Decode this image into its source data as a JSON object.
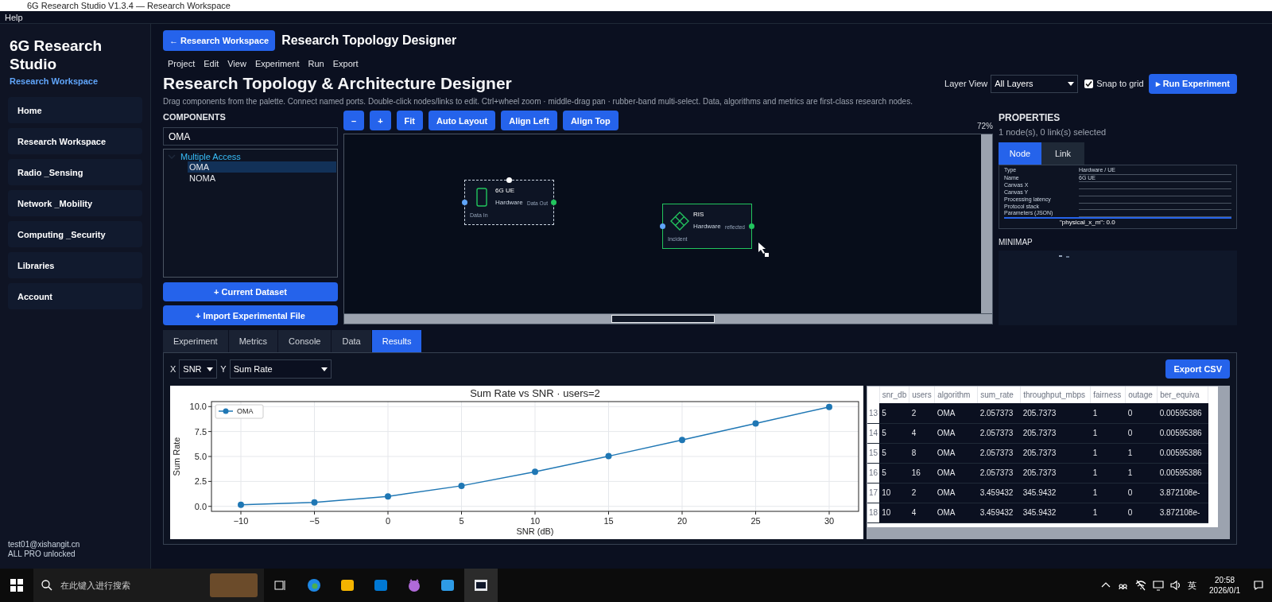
{
  "window": {
    "title": "6G Research Studio V1.3.4 — Research Workspace"
  },
  "menu_bar": [
    "Help"
  ],
  "sidebar": {
    "app_name": "6G Research Studio",
    "subtitle": "Research Workspace",
    "items": [
      {
        "label": "Home",
        "selected": false
      },
      {
        "label": "Research Workspace",
        "selected": false
      },
      {
        "label": "Radio _Sensing",
        "selected": false
      },
      {
        "label": "Network _Mobility",
        "selected": false
      },
      {
        "label": "Computing _Security",
        "selected": false
      },
      {
        "label": "Libraries",
        "selected": false
      },
      {
        "label": "Account",
        "selected": false
      }
    ],
    "user": "test01@xishangit.cn",
    "license": "ALL PRO unlocked"
  },
  "header": {
    "back_button": "← Research Workspace",
    "title": "Research Topology Designer",
    "menu": [
      "Project",
      "Edit",
      "View",
      "Experiment",
      "Run",
      "Export"
    ],
    "heading": "Research Topology & Architecture Designer",
    "description": "Drag components from the palette. Connect named ports. Double-click nodes/links to edit. Ctrl+wheel zoom · middle-drag pan · rubber-band multi-select. Data, algorithms and metrics are first-class research nodes.",
    "layer_view_label": "Layer View",
    "layer_view": "All Layers",
    "snap_to_grid": {
      "label": "Snap to grid",
      "checked": true
    },
    "run_button": "▸ Run Experiment"
  },
  "components": {
    "title": "COMPONENTS",
    "search": "OMA",
    "tree": [
      {
        "label": "Multiple Access",
        "expanded": true,
        "selected": false,
        "children": [
          {
            "label": "OMA",
            "selected": true
          },
          {
            "label": "NOMA",
            "selected": false
          }
        ]
      }
    ],
    "buttons": [
      "+ Current Dataset",
      "+ Import Experimental File"
    ]
  },
  "canvas": {
    "toolbar": [
      "–",
      "+",
      "Fit",
      "Auto Layout",
      "Align Left",
      "Align Top"
    ],
    "zoom": "72%",
    "nodes": [
      {
        "name": "6G UE",
        "type": "Hardware",
        "kind": "phone",
        "selected": true,
        "in_port": "Data In",
        "out_port": "Data Out"
      },
      {
        "name": "RIS",
        "type": "Hardware",
        "kind": "ris",
        "selected": false,
        "in_port": "Incident",
        "out_port": "reflected"
      }
    ]
  },
  "properties": {
    "title": "PROPERTIES",
    "selection": "1 node(s), 0 link(s) selected",
    "tabs": [
      {
        "label": "Node",
        "selected": true
      },
      {
        "label": "Link",
        "selected": false
      }
    ],
    "fields": [
      {
        "label": "Type",
        "value": "Hardware / UE"
      },
      {
        "label": "Name",
        "value": "6G UE"
      },
      {
        "label": "Canvas X"
      },
      {
        "label": "Canvas Y"
      },
      {
        "label": "Processing latency"
      },
      {
        "label": "Protocol stack"
      },
      {
        "label": "Parameters (JSON)"
      }
    ],
    "json": "\"physical_x_m\": 0.0",
    "minimap_title": "MINIMAP"
  },
  "bottom_tabs": [
    {
      "label": "Experiment",
      "selected": false
    },
    {
      "label": "Metrics",
      "selected": false
    },
    {
      "label": "Console",
      "selected": false
    },
    {
      "label": "Data",
      "selected": false
    },
    {
      "label": "Results",
      "selected": true
    }
  ],
  "results": {
    "x_label": "X",
    "x_value": "SNR",
    "y_label": "Y",
    "y_value": "Sum Rate",
    "export_button": "Export CSV",
    "chart_data": {
      "type": "line",
      "title": "Sum Rate vs SNR · users=2",
      "xlabel": "SNR (dB)",
      "ylabel": "Sum Rate",
      "x": [
        -10,
        -5,
        0,
        5,
        10,
        15,
        20,
        25,
        30
      ],
      "series": [
        {
          "name": "OMA",
          "color": "#1f77b4",
          "marker": "o",
          "values": [
            0.15,
            0.4,
            1.0,
            2.06,
            3.46,
            5.03,
            6.66,
            8.31,
            9.97
          ]
        }
      ],
      "grid": true,
      "xlim": [
        -12,
        32
      ],
      "ylim": [
        -0.5,
        10.5
      ],
      "xticks": [
        {
          "value": -10,
          "label": "−10"
        },
        {
          "value": -5,
          "label": "−5"
        },
        {
          "value": 0,
          "label": "0"
        },
        {
          "value": 5,
          "label": "5"
        },
        {
          "value": 10,
          "label": "10"
        },
        {
          "value": 15,
          "label": "15"
        },
        {
          "value": 20,
          "label": "20"
        },
        {
          "value": 25,
          "label": "25"
        },
        {
          "value": 30,
          "label": "30"
        }
      ],
      "yticks": [
        {
          "value": 0,
          "label": "0.0"
        },
        {
          "value": 2.5,
          "label": "2.5"
        },
        {
          "value": 5,
          "label": "5.0"
        },
        {
          "value": 7.5,
          "label": "7.5"
        },
        {
          "value": 10,
          "label": "10.0"
        }
      ]
    },
    "table": {
      "columns": [
        "snr_db",
        "users",
        "algorithm",
        "sum_rate",
        "throughput_mbps",
        "fairness",
        "outage",
        "ber_equiva"
      ],
      "rows": [
        {
          "index": "13",
          "cells": [
            "5",
            "2",
            "OMA",
            "2.057373",
            "205.7373",
            "1",
            "0",
            "0.00595386"
          ]
        },
        {
          "index": "14",
          "cells": [
            "5",
            "4",
            "OMA",
            "2.057373",
            "205.7373",
            "1",
            "0",
            "0.00595386"
          ]
        },
        {
          "index": "15",
          "cells": [
            "5",
            "8",
            "OMA",
            "2.057373",
            "205.7373",
            "1",
            "1",
            "0.00595386"
          ]
        },
        {
          "index": "16",
          "cells": [
            "5",
            "16",
            "OMA",
            "2.057373",
            "205.7373",
            "1",
            "1",
            "0.00595386"
          ]
        },
        {
          "index": "17",
          "cells": [
            "10",
            "2",
            "OMA",
            "3.459432",
            "345.9432",
            "1",
            "0",
            "3.872108e-"
          ]
        },
        {
          "index": "18",
          "cells": [
            "10",
            "4",
            "OMA",
            "3.459432",
            "345.9432",
            "1",
            "0",
            "3.872108e-"
          ]
        }
      ]
    }
  },
  "taskbar": {
    "search_placeholder": "在此键入进行搜索",
    "ime": "英",
    "time": "20:58",
    "date": "2026/0/1"
  }
}
